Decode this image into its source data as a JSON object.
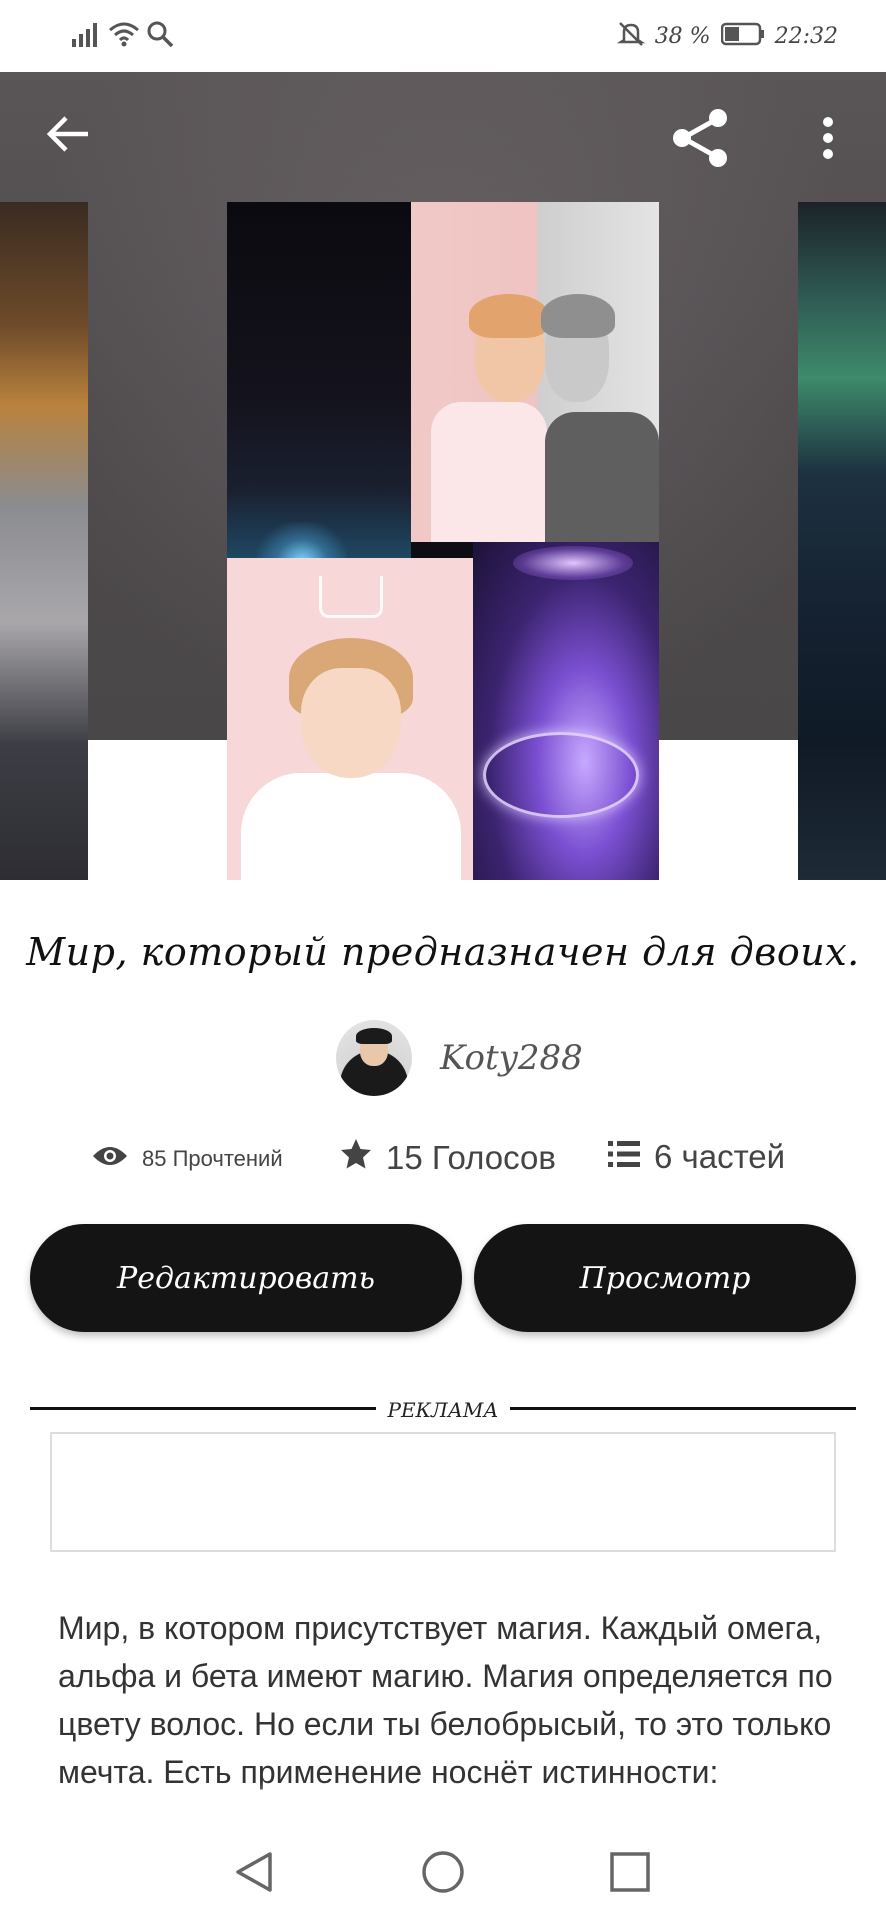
{
  "status_bar": {
    "battery_percent": "38 %",
    "time": "22:32",
    "icons": [
      "signal-icon",
      "wifi-icon",
      "search-icon",
      "bell-off-icon",
      "battery-icon"
    ]
  },
  "hero": {
    "icons": [
      "back-arrow-icon",
      "share-icon",
      "more-vertical-icon"
    ]
  },
  "story": {
    "title": "Мир, который предназначен для двоих.",
    "author": "Koty288"
  },
  "stats": {
    "reads": "85 Прочтений",
    "votes": "15 Голосов",
    "parts": "6 частей"
  },
  "actions": {
    "edit_label": "Редактировать",
    "view_label": "Просмотр"
  },
  "ad": {
    "label": "РЕКЛАМА"
  },
  "description": {
    "text": "Мир, в котором присутствует магия. Каждый омега, альфа и бета имеют магию. Магия определяется по цвету волос. Но если ты белобрысый, то это только мечта. Есть применение носнёт истинности:"
  },
  "nav": {
    "icons": [
      "triangle-back-icon",
      "circle-home-icon",
      "square-recents-icon"
    ]
  }
}
